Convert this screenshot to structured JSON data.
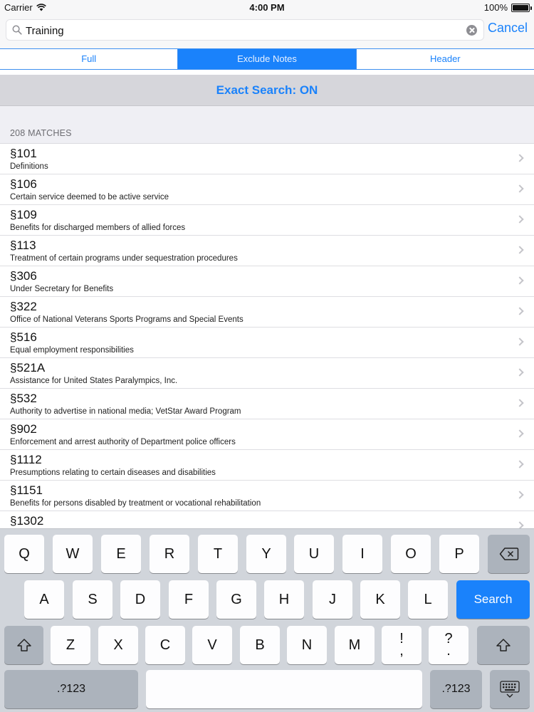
{
  "status_bar": {
    "carrier": "Carrier",
    "time": "4:00 PM",
    "battery": "100%",
    "battery_level": 1.0
  },
  "search": {
    "value": "Training",
    "cancel_label": "Cancel"
  },
  "segments": [
    {
      "label": "Full",
      "selected": false
    },
    {
      "label": "Exclude Notes",
      "selected": true
    },
    {
      "label": "Header",
      "selected": false
    }
  ],
  "exact_search": "Exact Search: ON",
  "matches_label": "208 MATCHES",
  "results": [
    {
      "section": "§101",
      "title": "Definitions"
    },
    {
      "section": "§106",
      "title": "Certain service deemed to be active service"
    },
    {
      "section": "§109",
      "title": "Benefits for discharged members of allied forces"
    },
    {
      "section": "§113",
      "title": "Treatment of certain programs under sequestration procedures"
    },
    {
      "section": "§306",
      "title": "Under Secretary for Benefits"
    },
    {
      "section": "§322",
      "title": "Office of National Veterans Sports Programs and Special Events"
    },
    {
      "section": "§516",
      "title": "Equal employment responsibilities"
    },
    {
      "section": "§521A",
      "title": "Assistance for United States Paralympics, Inc."
    },
    {
      "section": "§532",
      "title": "Authority to advertise in national media; VetStar Award Program"
    },
    {
      "section": "§902",
      "title": "Enforcement and arrest authority of Department police officers"
    },
    {
      "section": "§1112",
      "title": "Presumptions relating to certain diseases and disabilities"
    },
    {
      "section": "§1151",
      "title": "Benefits for persons disabled by treatment or vocational rehabilitation"
    },
    {
      "section": "§1302",
      "title": ""
    }
  ],
  "keyboard": {
    "row1": [
      "Q",
      "W",
      "E",
      "R",
      "T",
      "Y",
      "U",
      "I",
      "O",
      "P"
    ],
    "row2": [
      "A",
      "S",
      "D",
      "F",
      "G",
      "H",
      "J",
      "K",
      "L"
    ],
    "row3": [
      "Z",
      "X",
      "C",
      "V",
      "B",
      "N",
      "M"
    ],
    "exclaim_top": "!",
    "exclaim_bottom": ",",
    "question_top": "?",
    "question_bottom": ".",
    "search_label": "Search",
    "numbers_label": ".?123"
  },
  "colors": {
    "accent": "#1a82fb",
    "keyboard_bg": "#d1d5db"
  }
}
